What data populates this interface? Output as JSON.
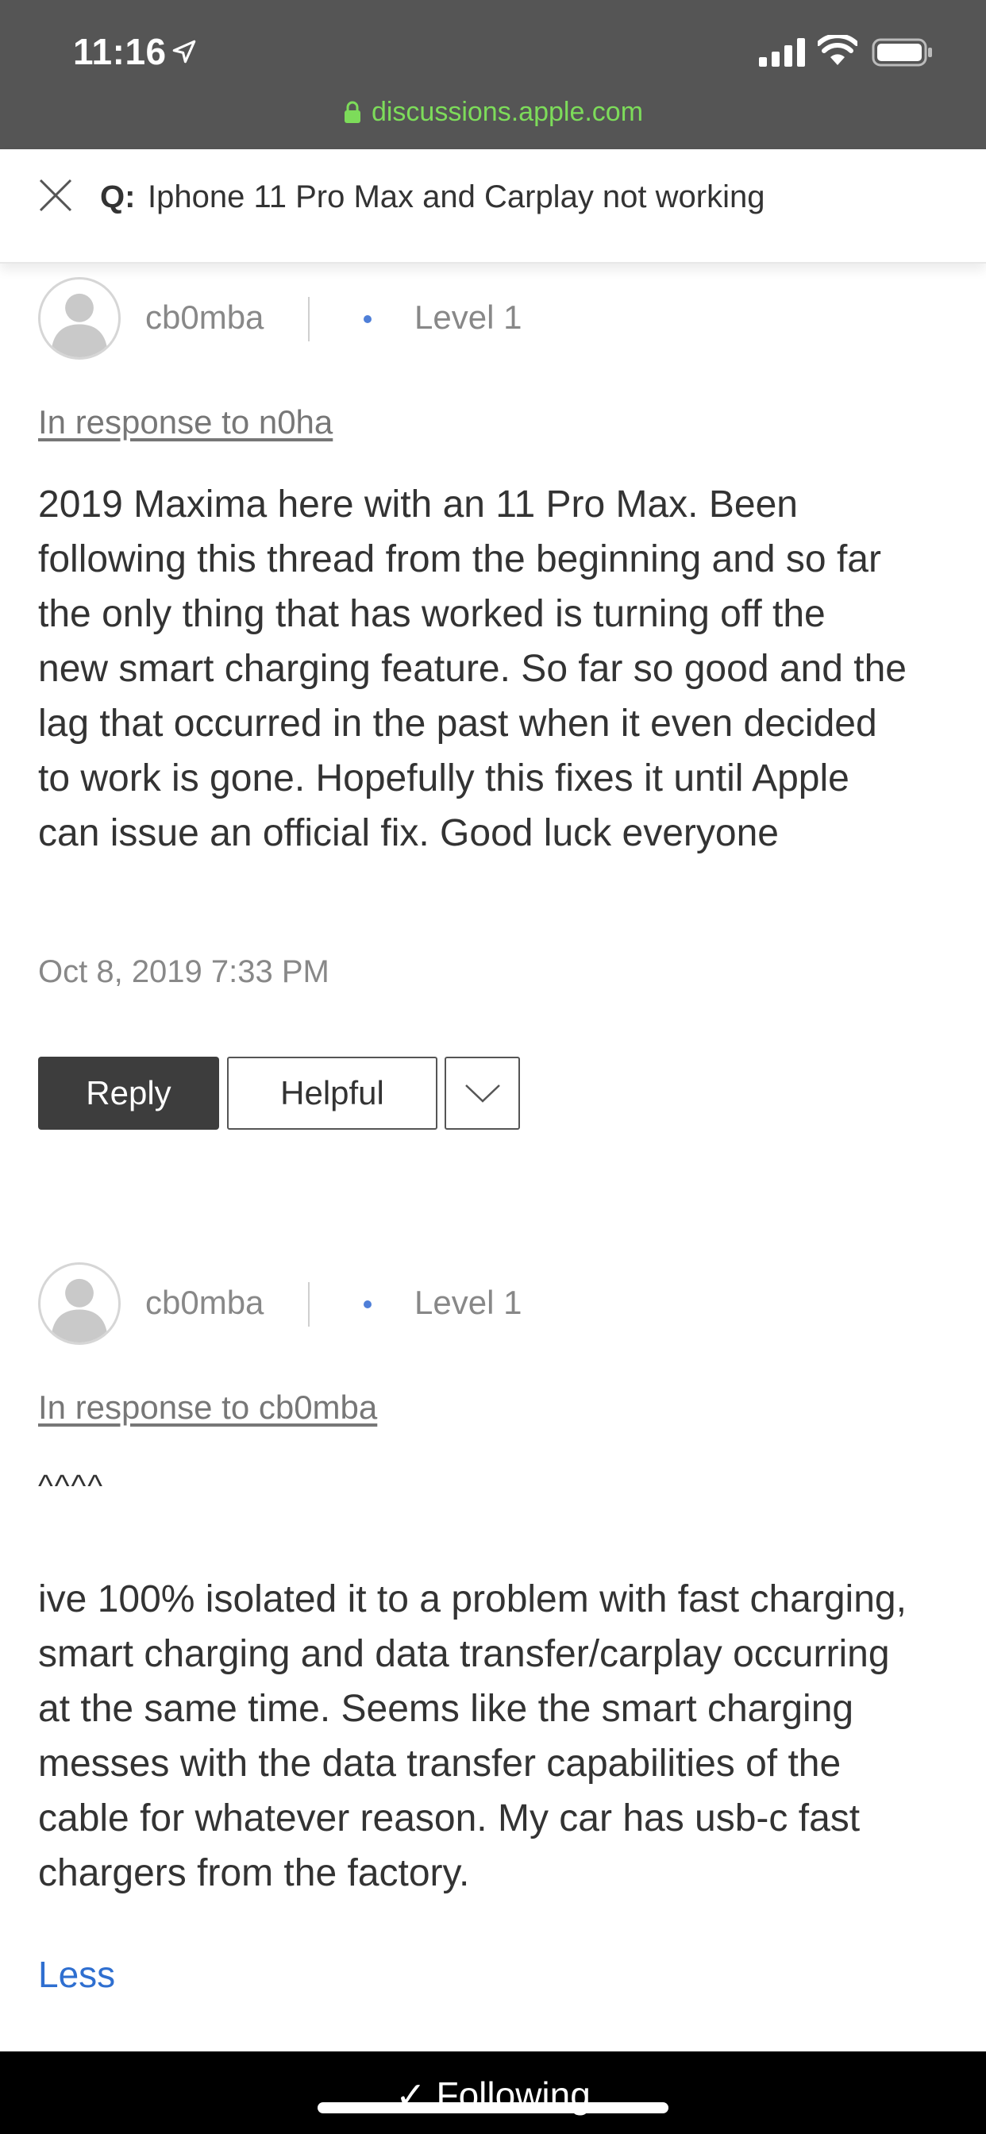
{
  "status_bar": {
    "time": "11:16",
    "url": "discussions.apple.com"
  },
  "header": {
    "q_label": "Q:",
    "title": "Iphone 11 Pro Max and Carplay not working"
  },
  "posts": [
    {
      "username": "cb0mba",
      "level": "Level 1",
      "in_response_to": "In response to n0ha",
      "lines": [
        "2019 Maxima here with an 11 Pro Max. Been",
        "following this thread from the beginning and so far",
        "the only thing that has worked is turning off the",
        "new smart charging feature. So far so good and the",
        "lag that occurred in the past when it even decided",
        "to work is gone. Hopefully this fixes it until Apple",
        "can issue an official fix. Good luck everyone"
      ],
      "date": "Oct 8, 2019 7:33 PM",
      "reply_label": "Reply",
      "helpful_label": "Helpful"
    },
    {
      "username": "cb0mba",
      "level": "Level 1",
      "in_response_to": "In response to cb0mba",
      "carets": "^^^^",
      "lines": [
        "ive 100% isolated it to a problem with fast charging,",
        "smart charging and data transfer/carplay occurring",
        "at the same time. Seems like the smart charging",
        "messes with the data transfer capabilities of the",
        "cable for whatever reason. My car has usb-c fast",
        "chargers from the factory."
      ],
      "less_label": "Less"
    }
  ],
  "bottom_bar": {
    "following_label": "✓ Following"
  },
  "colors": {
    "status_bg": "#555555",
    "url_green": "#7ddc5a",
    "link_blue": "#2f6fd0",
    "level_dot": "#4f7fd8",
    "reply_bg": "#3d3d3d"
  }
}
